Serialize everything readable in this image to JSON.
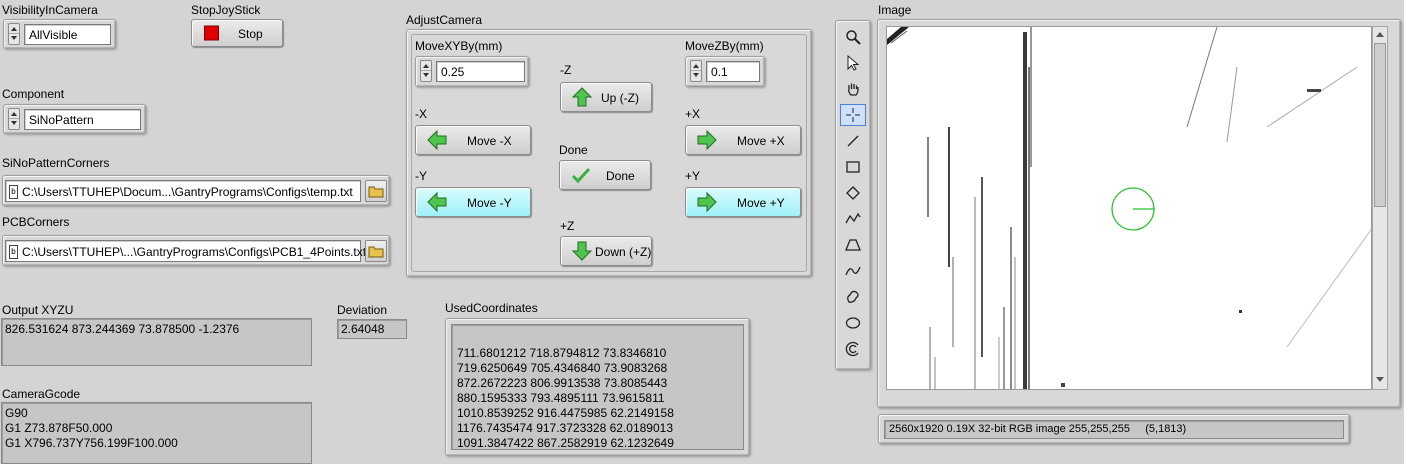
{
  "visibility": {
    "label": "VisibilityInCamera",
    "value": "AllVisible"
  },
  "stop_joystick": {
    "label": "StopJoyStick",
    "button": "Stop"
  },
  "component": {
    "label": "Component",
    "value": "SiNoPattern"
  },
  "sinopattern_corners": {
    "label": "SiNoPatternCorners",
    "path": "C:\\Users\\TTUHEP\\Docum...\\GantryPrograms\\Configs\\temp.txt"
  },
  "pcb_corners": {
    "label": "PCBCorners",
    "path": "C:\\Users\\TTUHEP\\...\\GantryPrograms\\Configs\\PCB1_4Points.txt"
  },
  "adjust_camera": {
    "title": "AdjustCamera",
    "movexy": {
      "label": "MoveXYBy(mm)",
      "value": "0.25"
    },
    "movez": {
      "label": "MoveZBy(mm)",
      "value": "0.1"
    },
    "minus_z_label": "-Z",
    "up_button": "Up (-Z)",
    "minus_x_label": "-X",
    "move_minus_x": "Move  -X",
    "plus_x_label": "+X",
    "move_plus_x": "Move +X",
    "done_label": "Done",
    "done_button": "Done",
    "minus_y_label": "-Y",
    "move_minus_y": "Move  -Y",
    "plus_y_label": "+Y",
    "move_plus_y": "Move  +Y",
    "plus_z_label": "+Z",
    "down_button": "Down (+Z)"
  },
  "output_xyzu": {
    "label": "Output XYZU",
    "value": "826.531624 873.244369 73.878500 -1.2376"
  },
  "deviation": {
    "label": "Deviation",
    "value": "2.64048"
  },
  "used_coordinates": {
    "label": "UsedCoordinates",
    "lines": [
      "711.6801212 718.8794812 73.8346810",
      "719.6250649 705.4346840 73.9083268",
      "872.2672223 806.9913538 73.8085443",
      "880.1595333 793.4895111 73.9615811",
      "1010.8539252 916.4475985 62.2149158",
      "1176.7435474 917.3723328 62.0189013",
      "1091.3847422 867.2582919 62.1232649"
    ]
  },
  "camera_gcode": {
    "label": "CameraGcode",
    "lines": [
      "G90",
      "G1 Z73.878F50.000",
      "G1 X796.737Y756.199F100.000"
    ]
  },
  "image": {
    "label": "Image",
    "status": "2560x1920 0.19X 32-bit RGB image 255,255,255     (5,1813)"
  },
  "colors": {
    "accent_green": "#2fc02f",
    "stop_red": "#e00000",
    "cyan_button": "#aef4fb"
  },
  "toolbar_icons": [
    "zoom-icon",
    "pointer-icon",
    "pan-hand-icon",
    "crosshair-icon",
    "line-icon",
    "rectangle-icon",
    "rotated-rectangle-icon",
    "polyline-icon",
    "polygon-icon",
    "freehand-line-icon",
    "freehand-region-icon",
    "oval-icon",
    "annulus-icon"
  ]
}
